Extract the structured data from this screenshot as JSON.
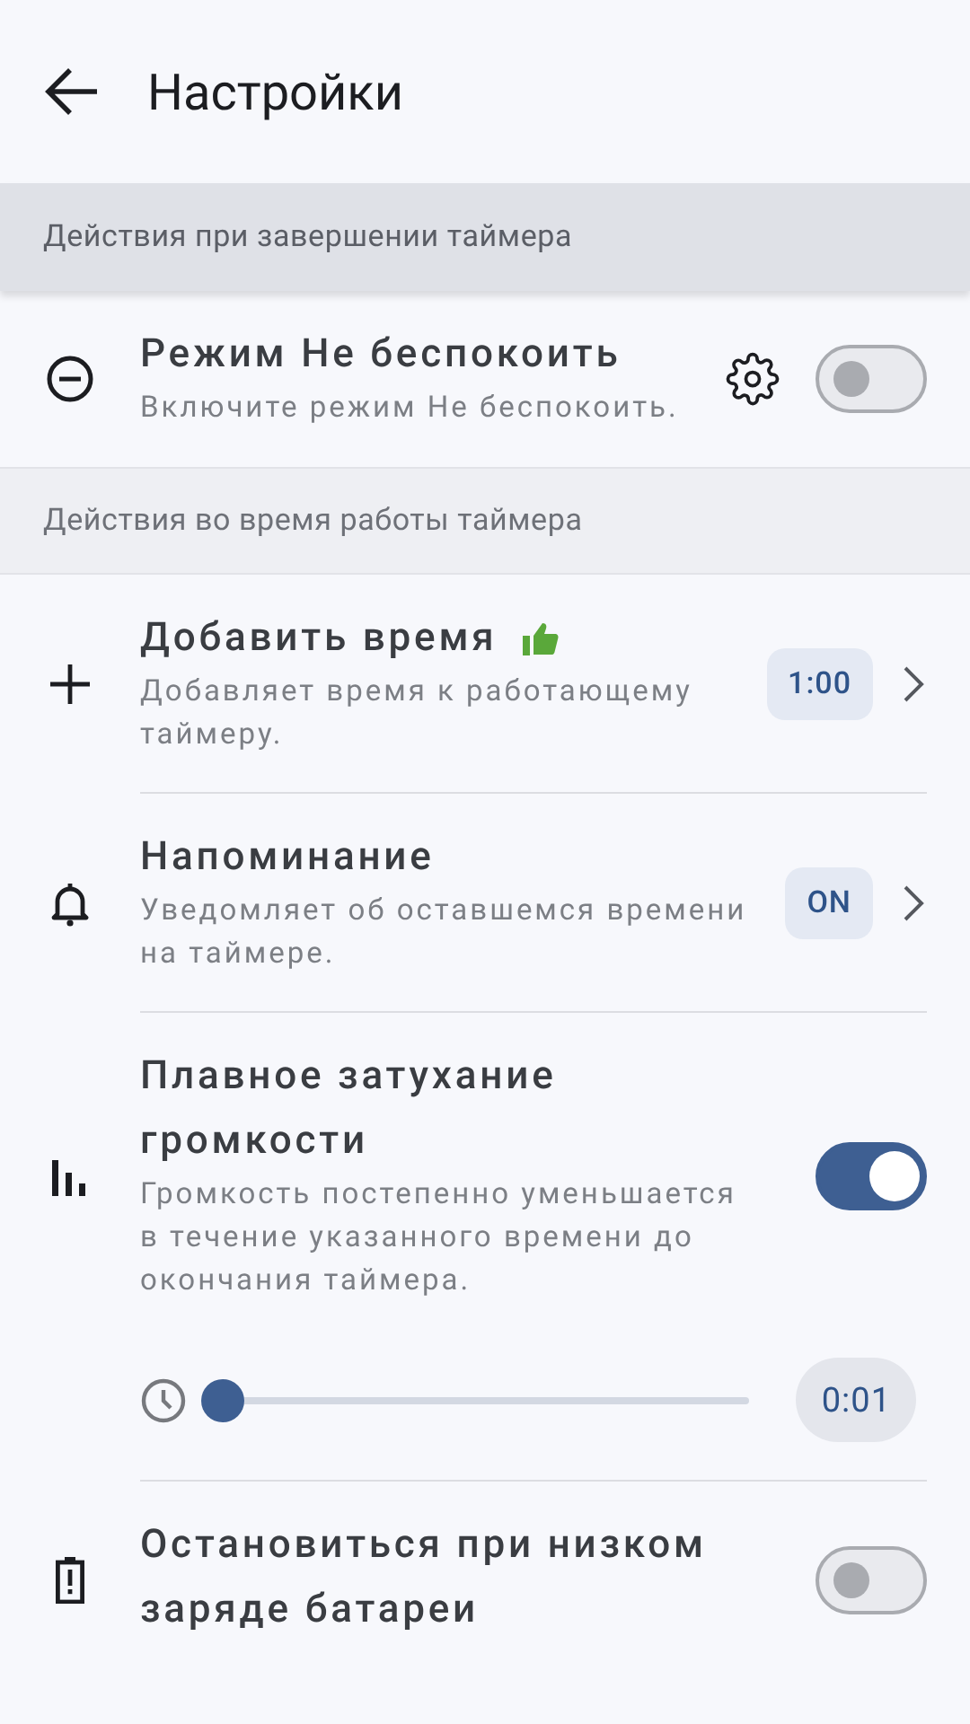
{
  "header": {
    "title": "Настройки"
  },
  "sections": [
    {
      "title": "Действия при завершении таймера",
      "kind": "shaded",
      "items": [
        {
          "kind": "gear-switch",
          "title": "Режим Не беспокоить",
          "description": "Включите режим Не беспокоить.",
          "on": false
        }
      ]
    },
    {
      "title": "Действия во время работы таймера",
      "kind": "plain",
      "items": [
        {
          "kind": "chip",
          "title": "Добавить время",
          "liked": true,
          "description": "Добавляет время к работающему таймеру.",
          "value": "1:00"
        },
        {
          "kind": "chip",
          "title": "Напоминание",
          "description": "Уведомляет об оставшемся времени на таймере.",
          "value": "ON"
        },
        {
          "kind": "switch",
          "title": "Плавное затухание громкости",
          "description": "Громкость постепенно уменьшается в течение указанного времени до окончания таймера.",
          "on": true,
          "slider": {
            "level": 0,
            "reading": "0:01"
          }
        },
        {
          "kind": "switch",
          "title": "Остановиться при низком заряде батареи",
          "on": false
        }
      ]
    }
  ]
}
